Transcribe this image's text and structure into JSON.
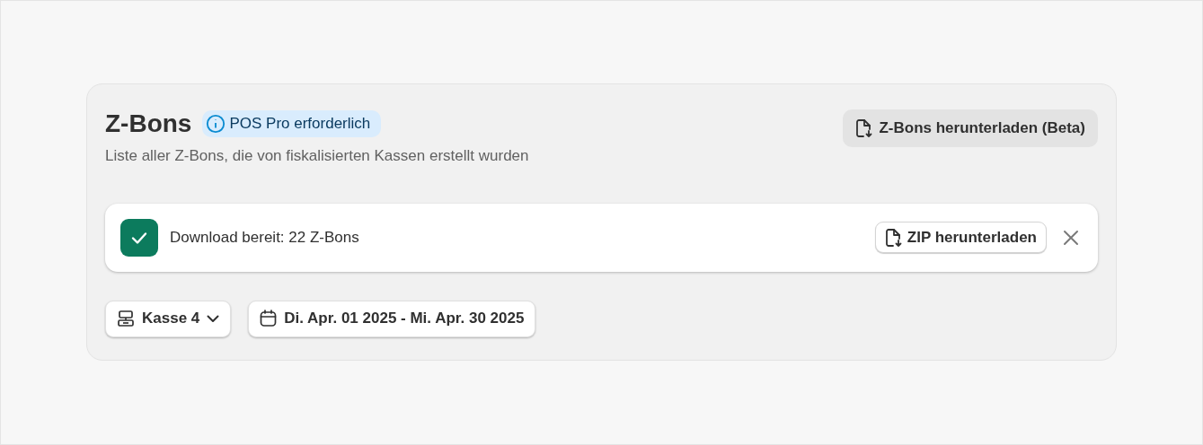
{
  "header": {
    "title": "Z-Bons",
    "badge": "POS Pro erforderlich",
    "subtitle": "Liste aller Z-Bons, die von fiskalisierten Kassen erstellt wurden",
    "download_button": "Z-Bons herunterladen (Beta)"
  },
  "banner": {
    "message": "Download bereit: 22 Z-Bons",
    "action": "ZIP herunterladen"
  },
  "filters": {
    "register": "Kasse 4",
    "date_range": "Di. Apr. 01 2025 - Mi. Apr. 30 2025"
  }
}
